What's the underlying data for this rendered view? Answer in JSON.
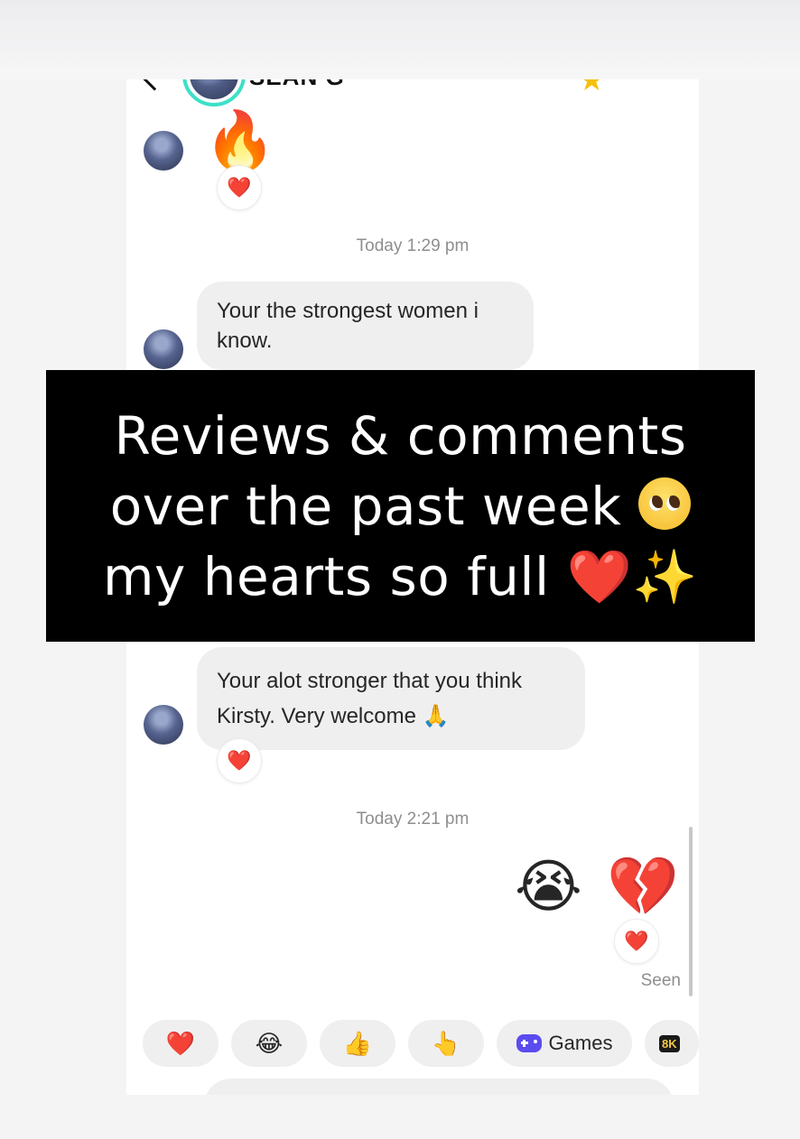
{
  "header": {
    "contact_name": "SEAN G",
    "icons": [
      "back-icon",
      "star-icon",
      "more-icon"
    ]
  },
  "messages": {
    "msg1_emoji": "🔥",
    "msg1_reaction": "❤️",
    "timestamp1": "Today 1:29 pm",
    "msg2_text": "Your the strongest women i know.",
    "msg3_text": "Your alot stronger that you think Kirsty. Very welcome 🙏",
    "msg3_reaction": "❤️",
    "timestamp2": "Today 2:21 pm",
    "sent_emoji_1": "😭",
    "sent_emoji_2": "💔",
    "sent_reaction": "❤️",
    "seen_label": "Seen"
  },
  "quick_reactions": {
    "heart": "❤️",
    "laugh": "😂",
    "thumbs_up": "👍",
    "point": "👆",
    "games_label": "Games",
    "badge_8k": "8K"
  },
  "overlay": {
    "line1": "Reviews & comments",
    "line2": "over the past week",
    "line3": "my hearts so full",
    "heart": "❤️",
    "sparkles": "✨"
  },
  "colors": {
    "avatar_ring": "#3ee0c8",
    "star": "#f5c010",
    "bubble": "#efefef",
    "heart": "#e0162b",
    "overlay_bg": "#000000",
    "overlay_text": "#ffffff"
  }
}
